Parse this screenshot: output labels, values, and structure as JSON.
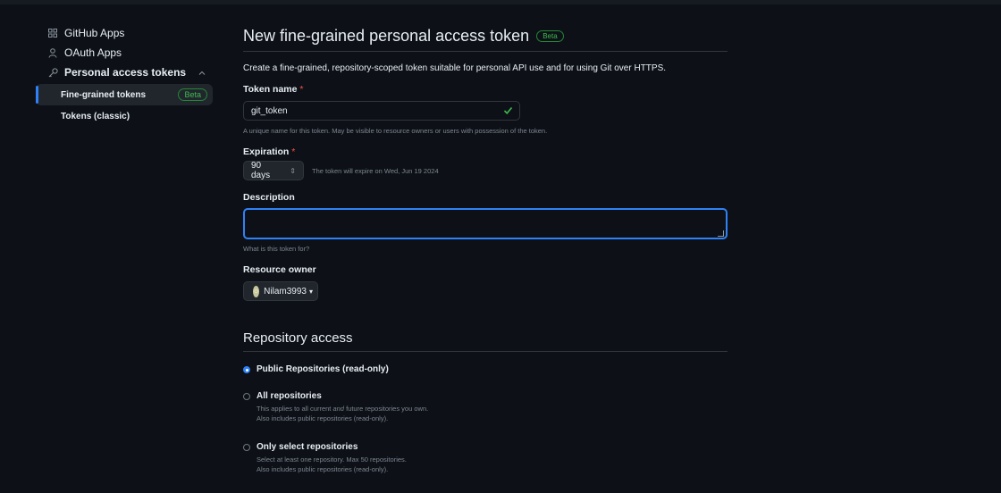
{
  "sidebar": {
    "items": [
      {
        "label": "GitHub Apps",
        "icon": "apps-grid-icon"
      },
      {
        "label": "OAuth Apps",
        "icon": "person-icon"
      },
      {
        "label": "Personal access tokens",
        "icon": "key-icon"
      }
    ],
    "sub_items": [
      {
        "label": "Fine-grained tokens",
        "badge": "Beta",
        "active": true
      },
      {
        "label": "Tokens (classic)"
      }
    ]
  },
  "page": {
    "title": "New fine-grained personal access token",
    "title_badge": "Beta",
    "intro": "Create a fine-grained, repository-scoped token suitable for personal API use and for using Git over HTTPS."
  },
  "token_name": {
    "label": "Token name",
    "required_mark": "*",
    "value": "git_token",
    "help": "A unique name for this token. May be visible to resource owners or users with possession of the token."
  },
  "expiration": {
    "label": "Expiration",
    "required_mark": "*",
    "selected": "90 days",
    "note": "The token will expire on Wed, Jun 19 2024"
  },
  "description": {
    "label": "Description",
    "value": "",
    "help": "What is this token for?"
  },
  "resource_owner": {
    "label": "Resource owner",
    "value": "Nilam3993"
  },
  "repository_access": {
    "title": "Repository access",
    "options": [
      {
        "label": "Public Repositories (read-only)",
        "checked": true
      },
      {
        "label": "All repositories",
        "desc1_pre": "This applies to all current ",
        "desc1_em": "and",
        "desc1_post": " future repositories you own.",
        "desc2": "Also includes public repositories (read-only).",
        "checked": false
      },
      {
        "label": "Only select repositories",
        "desc1": "Select at least one repository. Max 50 repositories.",
        "desc2": "Also includes public repositories (read-only).",
        "checked": false
      }
    ]
  },
  "colors": {
    "background": "#0d1117",
    "accent": "#2f81f7",
    "success": "#3fb950",
    "danger": "#f85149"
  }
}
